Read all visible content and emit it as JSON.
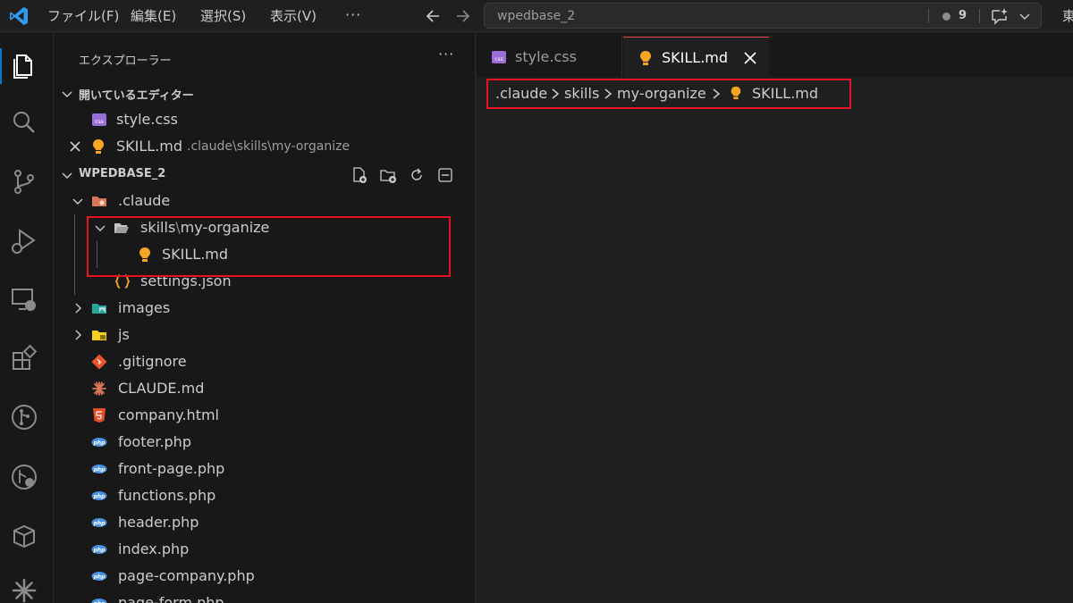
{
  "titlebar": {
    "menus": [
      "ファイル(F)",
      "編集(E)",
      "選択(S)",
      "表示(V)"
    ],
    "more": "···",
    "search_text": "wpedbase_2",
    "notification_count": "9",
    "edge_text": "東"
  },
  "explorer": {
    "title": "エクスプローラー",
    "more": "···",
    "open_editors": {
      "header": "開いているエディター",
      "items": [
        {
          "name": "style.css",
          "desc": ""
        },
        {
          "name": "SKILL.md",
          "desc": ".claude\\skills\\my-organize"
        }
      ]
    },
    "workspace": {
      "header": "WPEDBASE_2",
      "items": [
        {
          "name": ".claude",
          "icon": "claude-folder-icon"
        },
        {
          "name": "skills",
          "sep": "\\",
          "name2": "my-organize",
          "icon": "folder-open-icon"
        },
        {
          "name": "SKILL.md",
          "icon": "lightbulb-icon"
        },
        {
          "name": "settings.json",
          "icon": "json-icon"
        },
        {
          "name": "images",
          "icon": "images-folder-icon"
        },
        {
          "name": "js",
          "icon": "js-folder-icon"
        },
        {
          "name": ".gitignore",
          "icon": "git-icon"
        },
        {
          "name": "CLAUDE.md",
          "icon": "claude-icon"
        },
        {
          "name": "company.html",
          "icon": "html-icon"
        },
        {
          "name": "footer.php",
          "icon": "php-icon"
        },
        {
          "name": "front-page.php",
          "icon": "php-icon"
        },
        {
          "name": "functions.php",
          "icon": "php-icon"
        },
        {
          "name": "header.php",
          "icon": "php-icon"
        },
        {
          "name": "index.php",
          "icon": "php-icon"
        },
        {
          "name": "page-company.php",
          "icon": "php-icon"
        },
        {
          "name": "page-form.php",
          "icon": "php-icon"
        }
      ]
    }
  },
  "editor": {
    "tabs": [
      {
        "label": "style.css",
        "active": false
      },
      {
        "label": "SKILL.md",
        "active": true
      }
    ],
    "breadcrumb": [
      ".claude",
      "skills",
      "my-organize",
      "SKILL.md"
    ]
  },
  "colors": {
    "accent": "#0078d4",
    "highlight": "#e81123",
    "php": "#4a90e2",
    "html": "#e44d26",
    "lightbulb": "#f5a623"
  }
}
